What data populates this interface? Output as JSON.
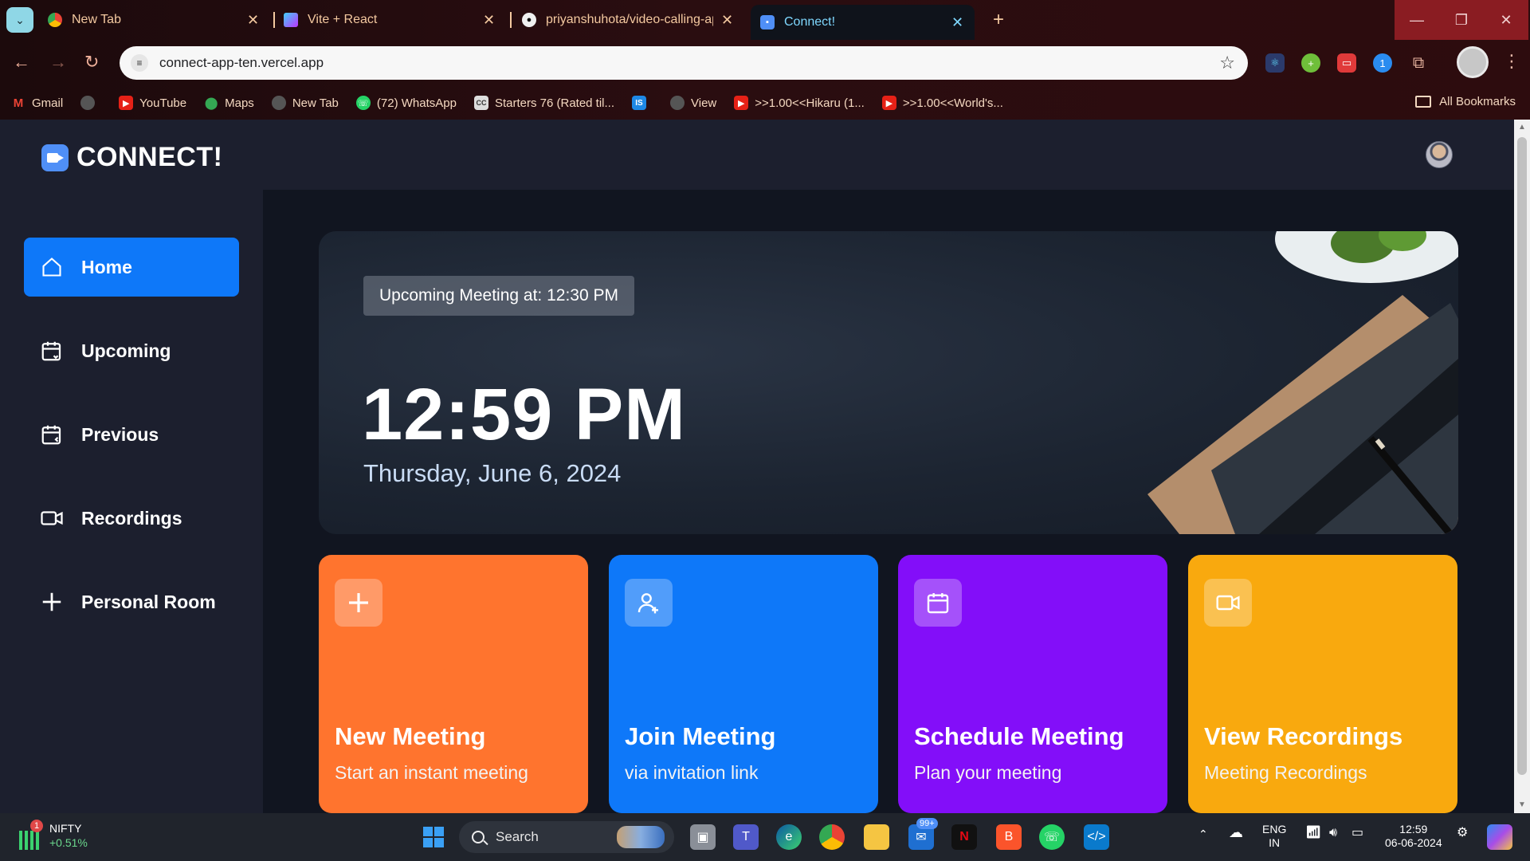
{
  "browser": {
    "tabs": [
      {
        "title": "New Tab",
        "favicon": "chrome-icon"
      },
      {
        "title": "Vite + React",
        "favicon": "vite-icon"
      },
      {
        "title": "priyanshuhota/video-calling-ap",
        "favicon": "github-icon"
      },
      {
        "title": "Connect!",
        "favicon": "connect-icon",
        "active": true
      }
    ],
    "url": "connect-app-ten.vercel.app",
    "bookmarks": [
      {
        "label": "Gmail",
        "icon": "gmail-icon"
      },
      {
        "label": "",
        "icon": "globe-icon"
      },
      {
        "label": "YouTube",
        "icon": "youtube-icon"
      },
      {
        "label": "Maps",
        "icon": "maps-icon"
      },
      {
        "label": "New Tab",
        "icon": "globe-icon"
      },
      {
        "label": "(72) WhatsApp",
        "icon": "whatsapp-icon"
      },
      {
        "label": "Starters 76 (Rated til...",
        "icon": "codechef-icon"
      },
      {
        "label": "",
        "icon": "is-icon"
      },
      {
        "label": "View",
        "icon": "globe-icon"
      },
      {
        "label": ">>1.00<<Hikaru (1...",
        "icon": "youtube-icon"
      },
      {
        "label": ">>1.00<<World's...",
        "icon": "youtube-icon"
      }
    ],
    "all_bookmarks": "All Bookmarks"
  },
  "app": {
    "brand": "CONNECT!",
    "nav": [
      {
        "label": "Home",
        "icon": "home-icon",
        "active": true
      },
      {
        "label": "Upcoming",
        "icon": "calendar-upcoming-icon"
      },
      {
        "label": "Previous",
        "icon": "calendar-previous-icon"
      },
      {
        "label": "Recordings",
        "icon": "video-icon"
      },
      {
        "label": "Personal Room",
        "icon": "plus-icon"
      }
    ],
    "hero": {
      "upcoming": "Upcoming Meeting at: 12:30 PM",
      "time": "12:59 PM",
      "date": "Thursday, June 6, 2024"
    },
    "cards": [
      {
        "title": "New Meeting",
        "subtitle": "Start an instant meeting",
        "icon": "plus-icon",
        "color": "#ff742e"
      },
      {
        "title": "Join Meeting",
        "subtitle": "via invitation link",
        "icon": "user-plus-icon",
        "color": "#0e78f9"
      },
      {
        "title": "Schedule Meeting",
        "subtitle": "Plan your meeting",
        "icon": "calendar-icon",
        "color": "#830ef9"
      },
      {
        "title": "View Recordings",
        "subtitle": "Meeting Recordings",
        "icon": "video-icon",
        "color": "#f9a90e"
      }
    ]
  },
  "taskbar": {
    "nifty": {
      "name": "NIFTY",
      "change": "+0.51%",
      "badge": "1"
    },
    "search": "Search",
    "mail_badge": "99+",
    "lang": {
      "line1": "ENG",
      "line2": "IN"
    },
    "clock": {
      "time": "12:59",
      "date": "06-06-2024"
    }
  }
}
